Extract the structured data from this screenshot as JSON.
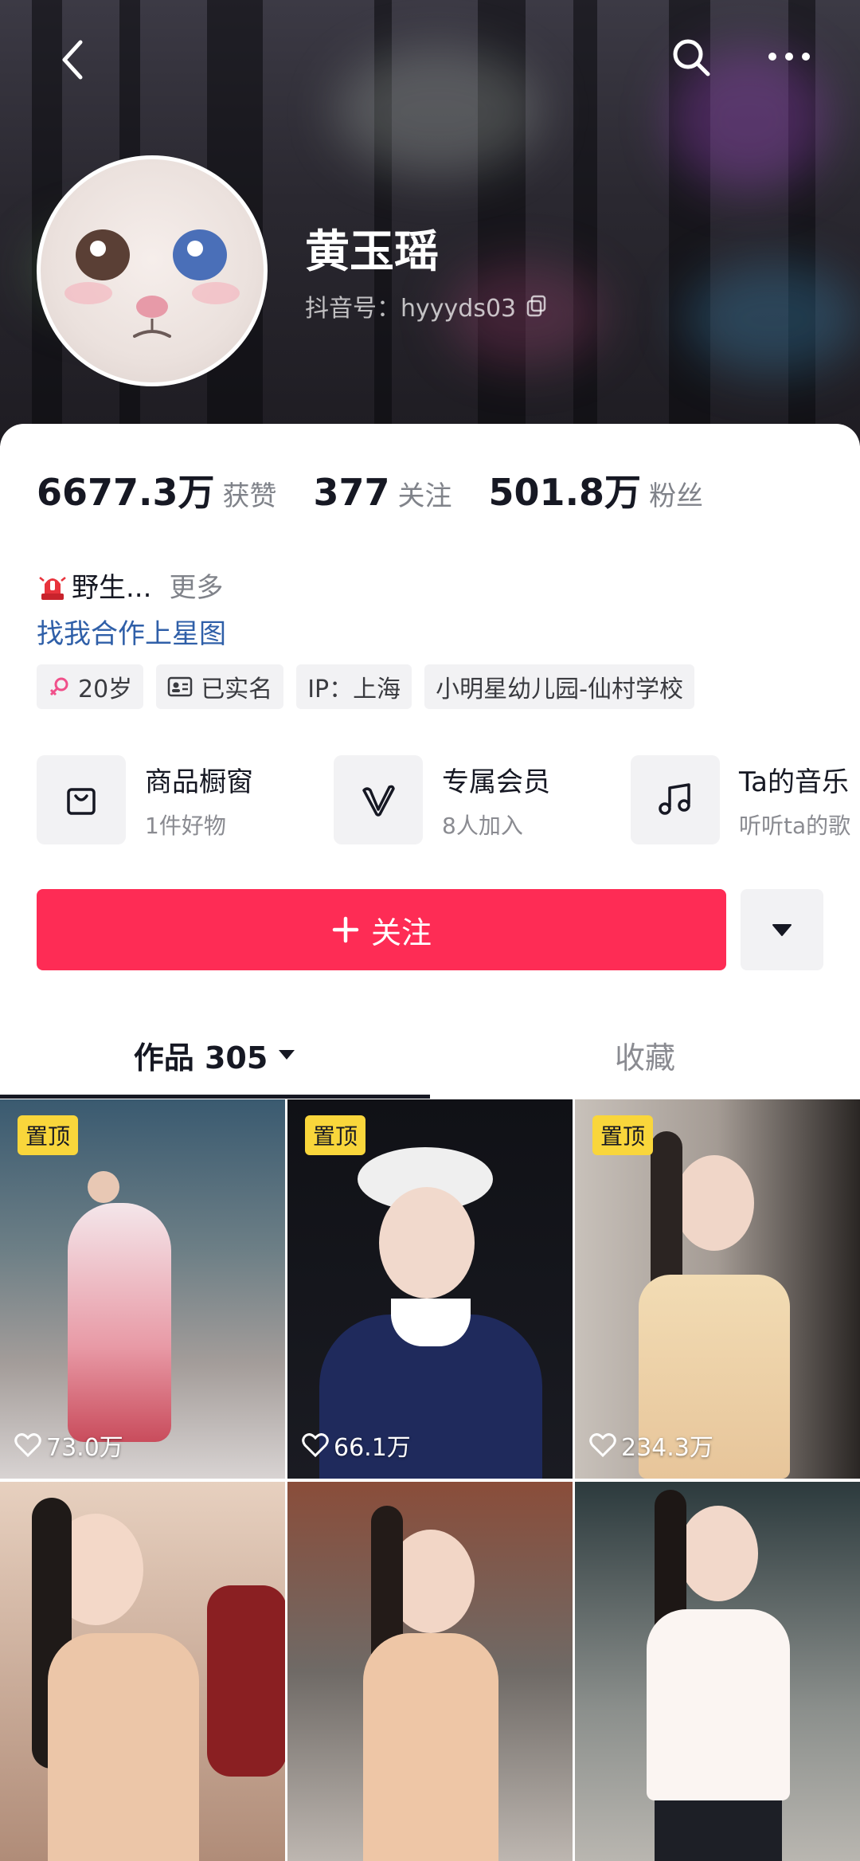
{
  "header": {
    "back_icon": "chevron-left-icon",
    "search_icon": "search-icon",
    "more_icon": "more-dots-icon"
  },
  "profile": {
    "name": "黄玉瑶",
    "douyin_id": "抖音号：hyyyds03",
    "copy_icon": "copy-icon"
  },
  "stats": [
    {
      "value": "6677.3万",
      "label": "获赞"
    },
    {
      "value": "377",
      "label": "关注"
    },
    {
      "value": "501.8万",
      "label": "粉丝"
    }
  ],
  "bio": {
    "icon": "siren-icon",
    "text": "野生...",
    "more": "更多",
    "link": "找我合作上星图"
  },
  "tags": [
    {
      "icon": "female-icon",
      "label": "20岁"
    },
    {
      "icon": "id-card-icon",
      "label": "已实名"
    },
    {
      "label": "IP：上海"
    },
    {
      "label": "小明星幼儿园-仙村学校"
    }
  ],
  "features": [
    {
      "icon": "shopping-bag-icon",
      "title": "商品橱窗",
      "sub": "1件好物"
    },
    {
      "icon": "v-badge-icon",
      "title": "专属会员",
      "sub": "8人加入"
    },
    {
      "icon": "music-note-icon",
      "title": "Ta的音乐",
      "sub": "听听ta的歌"
    }
  ],
  "actions": {
    "follow": "关注",
    "follow_icon": "plus-icon",
    "dropdown_icon": "triangle-down-icon"
  },
  "tabs": [
    {
      "label": "作品 305",
      "active": true
    },
    {
      "label": "收藏",
      "active": false
    }
  ],
  "videos": [
    {
      "pinned": "置顶",
      "likes": "73.0万"
    },
    {
      "pinned": "置顶",
      "likes": "66.1万"
    },
    {
      "pinned": "置顶",
      "likes": "234.3万"
    },
    {
      "pinned": "",
      "likes": ""
    },
    {
      "pinned": "",
      "likes": ""
    },
    {
      "pinned": "",
      "likes": ""
    }
  ],
  "colors": {
    "accent": "#fe2c55",
    "link": "#2f5fa8",
    "pin_badge": "#f9d63b"
  }
}
